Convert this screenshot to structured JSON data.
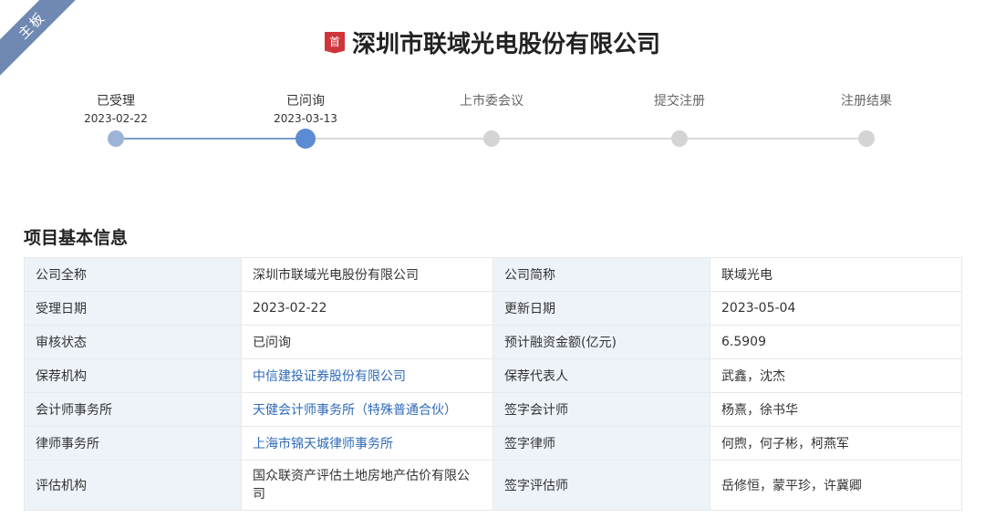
{
  "board_tag": "主板",
  "company_title": "深圳市联域光电股份有限公司",
  "title_badge": "首",
  "progress": {
    "completed_steps": 2,
    "steps": [
      {
        "name": "已受理",
        "date": "2023-02-22",
        "status": "done"
      },
      {
        "name": "已问询",
        "date": "2023-03-13",
        "status": "current"
      },
      {
        "name": "上市委会议",
        "date": "",
        "status": "pending"
      },
      {
        "name": "提交注册",
        "date": "",
        "status": "pending"
      },
      {
        "name": "注册结果",
        "date": "",
        "status": "pending"
      }
    ]
  },
  "section_title": "项目基本信息",
  "info_rows": [
    {
      "l1": "公司全称",
      "v1": "深圳市联域光电股份有限公司",
      "l2": "公司简称",
      "v2": "联域光电"
    },
    {
      "l1": "受理日期",
      "v1": "2023-02-22",
      "l2": "更新日期",
      "v2": "2023-05-04"
    },
    {
      "l1": "审核状态",
      "v1": "已问询",
      "l2": "预计融资金额(亿元)",
      "v2": "6.5909"
    },
    {
      "l1": "保荐机构",
      "v1": "中信建投证券股份有限公司",
      "l2": "保荐代表人",
      "v2": "武鑫，沈杰"
    },
    {
      "l1": "会计师事务所",
      "v1": "天健会计师事务所（特殊普通合伙）",
      "l2": "签字会计师",
      "v2": "杨熹，徐书华"
    },
    {
      "l1": "律师事务所",
      "v1": "上海市锦天城律师事务所",
      "l2": "签字律师",
      "v2": "何煦，何子彬，柯燕军"
    },
    {
      "l1": "评估机构",
      "v1": "国众联资产评估土地房地产估价有限公司",
      "l2": "签字评估师",
      "v2": "岳修恒，蒙平珍，许冀卿"
    }
  ],
  "colors": {
    "accent": "#6f89b3",
    "step_done": "#9db4d8",
    "step_current": "#5b8bd2",
    "step_pending": "#d4d4d4",
    "link": "#2f6bb8",
    "label_bg": "#eef3fa",
    "badge_red": "#d0343b"
  }
}
